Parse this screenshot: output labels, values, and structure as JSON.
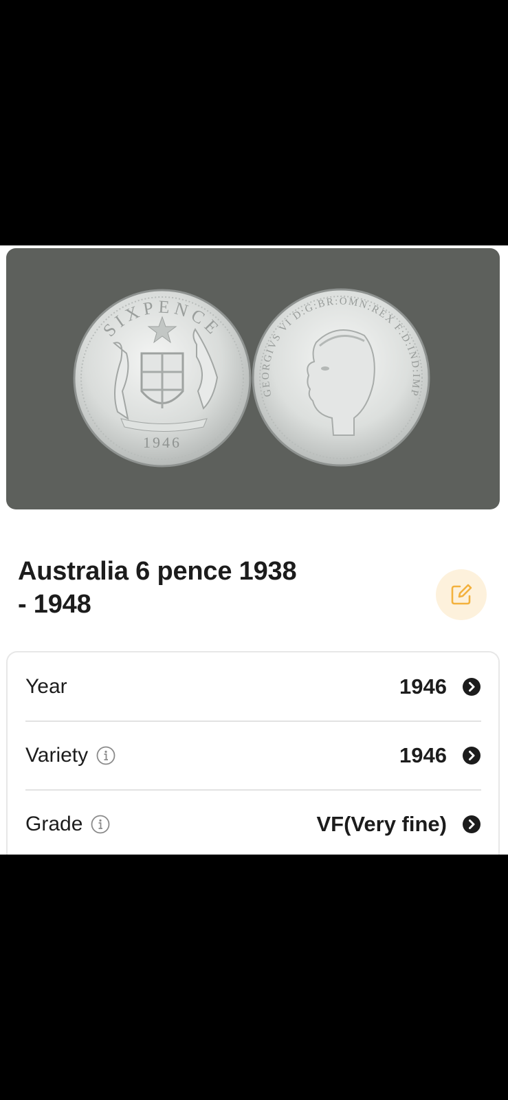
{
  "coin": {
    "title_line1": "Australia 6 pence 1938",
    "title_line2": "- 1948",
    "reverse_legend": "SIXPENCE",
    "reverse_year": "1946",
    "obverse_legend": "GEORGIVS VI D:G:BR:OMN:REX F:D:IND:IMP"
  },
  "details": [
    {
      "label": "Year",
      "value": "1946",
      "has_info": false
    },
    {
      "label": "Variety",
      "value": "1946",
      "has_info": true
    },
    {
      "label": "Grade",
      "value": "VF(Very fine)",
      "has_info": true
    }
  ],
  "icons": {
    "edit": "edit-icon",
    "info": "info-icon",
    "chevron": "chevron-right-icon"
  },
  "colors": {
    "photo_bg": "#5d605c",
    "edit_bg": "#fdf1dc",
    "edit_accent": "#f3b13d",
    "text": "#1c1c1c"
  }
}
